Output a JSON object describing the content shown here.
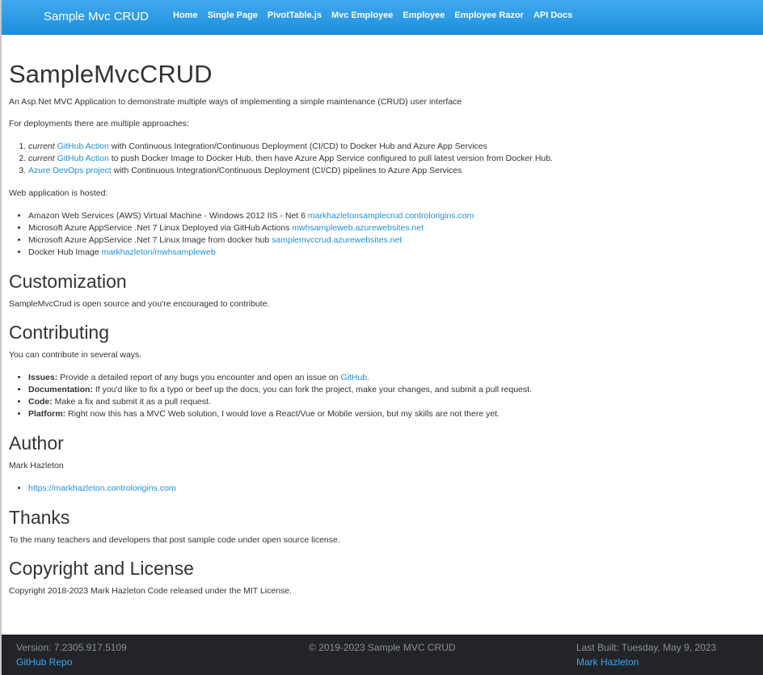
{
  "navbar": {
    "brand": "Sample Mvc CRUD",
    "links": [
      "Home",
      "Single Page",
      "PivotTable.js",
      "Mvc Employee",
      "Employee",
      "Employee Razor",
      "API Docs"
    ]
  },
  "main": {
    "title": "SampleMvcCRUD",
    "intro": "An Asp.Net MVC Application to demonstrate multiple ways of implementing a simple maintenance (CRUD) user interface",
    "deployments_heading": "For deployments there are multiple approaches:",
    "deployments": [
      {
        "em": "current",
        "link": "GitHub Action",
        "text": " with Continuous Integration/Continuous Deployment (CI/CD) to Docker Hub and Azure App Services"
      },
      {
        "em": "current",
        "link": "GitHub Action",
        "text": " to push Docker Image to Docker Hub, then have Azure App Service configured to pull latest version from Docker Hub."
      },
      {
        "em": "",
        "link": "Azure DevOps project",
        "text": " with Continuous Integration/Continuous Deployment (CI/CD) pipelines to Azure App Services"
      }
    ],
    "hosted_heading": "Web application is hosted:",
    "hosted": [
      {
        "text": "Amazon Web Services (AWS) Virtual Machine - Windows 2012 IIS - Net 6 ",
        "link": "markhazletonsamplecrud.controlorigins.com"
      },
      {
        "text": "Microsoft Azure AppService .Net 7 Linux Deployed via GitHub Actions ",
        "link": "mwhsampleweb.azurewebsites.net"
      },
      {
        "text": "Microsoft Azure AppService .Net 7 Linux Image from docker hub ",
        "link": "samplemvccrud.azurewebsites.net"
      },
      {
        "text": "Docker Hub Image ",
        "link": "markhazleton/mwhsampleweb"
      }
    ],
    "customization_title": "Customization",
    "customization_text": "SampleMvcCrud is open source and you're encouraged to contribute.",
    "contributing_title": "Contributing",
    "contributing_text": "You can contribute in several ways.",
    "contributing": [
      {
        "label": "Issues:",
        "text": " Provide a detailed report of any bugs you encounter and open an issue on ",
        "link": "GitHub."
      },
      {
        "label": "Documentation:",
        "text": " If you'd like to fix a typo or beef up the docs, you can fork the project, make your changes, and submit a pull request.",
        "link": ""
      },
      {
        "label": "Code:",
        "text": " Make a fix and submit it as a pull request.",
        "link": ""
      },
      {
        "label": "Platform:",
        "text": " Right now this has a MVC Web solution, I would love a React/Vue or Mobile version, but my skills are not there yet.",
        "link": ""
      }
    ],
    "author_title": "Author",
    "author_name": "Mark Hazleton",
    "author_link": "https://markhazleton.controlorigins.com",
    "thanks_title": "Thanks",
    "thanks_text": "To the many teachers and developers that post sample code under open source license.",
    "license_title": "Copyright and License",
    "license_text": "Copyright 2018-2023 Mark Hazleton Code released under the MIT License."
  },
  "footer": {
    "version": "Version: 7.2305.917.5109",
    "repo_link": "GitHub Repo",
    "copyright": "© 2019-2023 Sample MVC CRUD",
    "last_built": "Last Built: Tuesday, May 9, 2023",
    "author_link": "Mark Hazleton"
  },
  "colors": {
    "navbar": "#2196e8",
    "link": "#1e8fdc",
    "footer_bg": "#222427"
  }
}
